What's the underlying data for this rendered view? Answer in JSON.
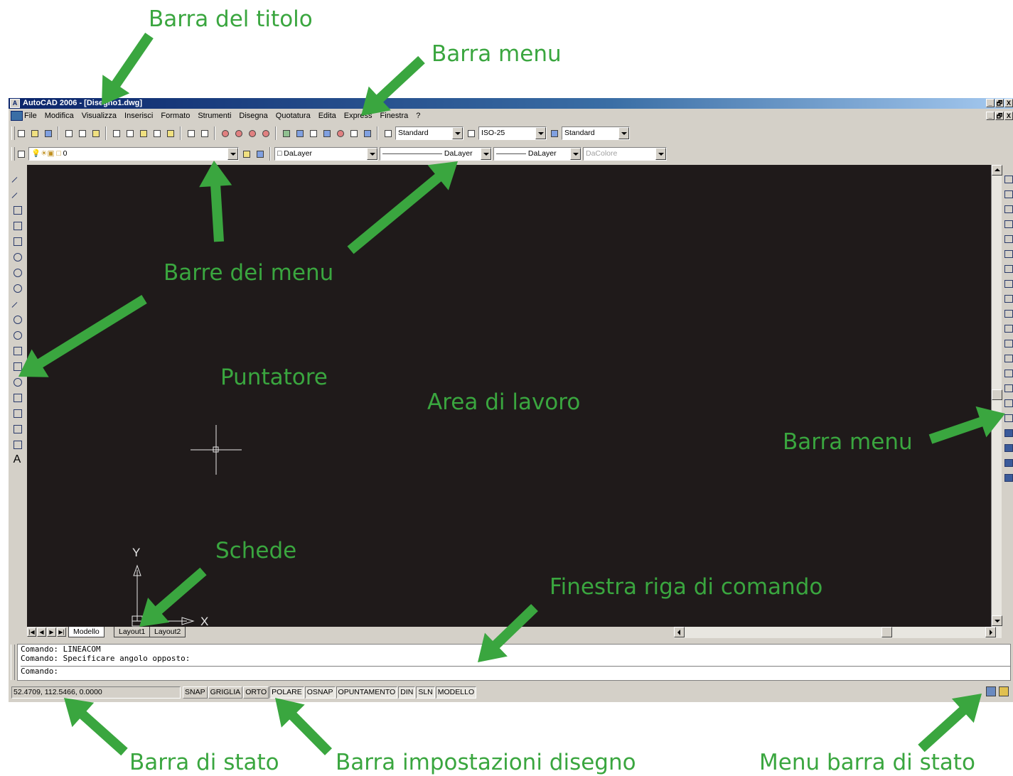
{
  "annotations": {
    "title_bar": "Barra del titolo",
    "menu_bar_top": "Barra menu",
    "toolbars": "Barre dei menu",
    "pointer": "Puntatore",
    "work_area": "Area di lavoro",
    "menu_bar_right": "Barra menu",
    "tabs": "Schede",
    "command_window": "Finestra riga di comando",
    "status_bar": "Barra di stato",
    "drawing_settings_bar": "Barra impostazioni disegno",
    "status_bar_menu": "Menu barra di stato"
  },
  "window": {
    "title": "AutoCAD 2006 - [Disegno1.dwg]",
    "controls": {
      "minimize": "_",
      "restore": "🗗",
      "close": "X"
    }
  },
  "menu": {
    "items": [
      "File",
      "Modifica",
      "Visualizza",
      "Inserisci",
      "Formato",
      "Strumenti",
      "Disegna",
      "Quotatura",
      "Edita",
      "Express",
      "Finestra",
      "?"
    ]
  },
  "toolbar1": {
    "text_style": "Standard",
    "dim_style": "ISO-25",
    "table_style": "Standard"
  },
  "toolbar2": {
    "layer": "0",
    "color": "DaLayer",
    "linetype": "DaLayer",
    "lineweight": "DaLayer",
    "plot_style": "DaColore"
  },
  "ucs": {
    "y_label": "Y",
    "x_label": "X"
  },
  "tabs": [
    "Modello",
    "Layout1",
    "Layout2"
  ],
  "command": {
    "lines": [
      "Comando: LINEACOM",
      "Comando: Specificare angolo opposto:"
    ],
    "prompt": "Comando:"
  },
  "status": {
    "coords": "52.4709, 112.5466, 0.0000",
    "buttons": [
      "SNAP",
      "GRIGLIA",
      "ORTO",
      "POLARE",
      "OSNAP",
      "OPUNTAMENTO",
      "DIN",
      "SLN",
      "MODELLO"
    ]
  },
  "colors": {
    "annotation_green": "#3aa63f",
    "workarea_bg": "#1f1a1a",
    "titlebar": "#0a246a"
  }
}
